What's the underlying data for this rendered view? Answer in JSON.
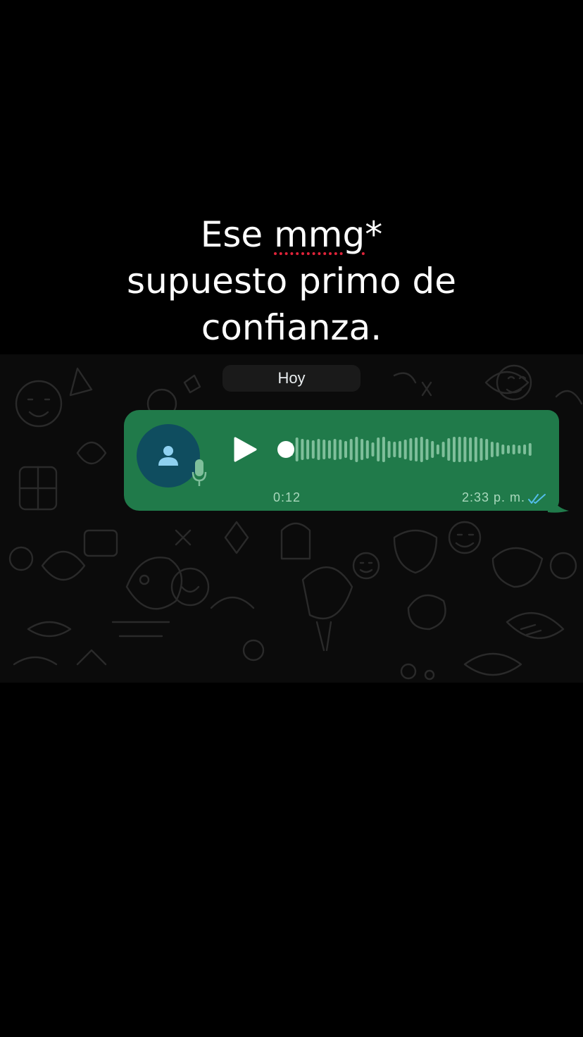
{
  "caption": {
    "line1_prefix": "Ese ",
    "line1_word": "mmg",
    "line1_suffix": "*",
    "line2": "supuesto primo de",
    "line3": "confianza."
  },
  "chat": {
    "date_chip": "Hoy",
    "voice_message": {
      "duration": "0:12",
      "time": "2:33 p. m.",
      "status": "read",
      "status_icon": "double-check-icon",
      "play_icon": "play-icon",
      "avatar_icon": "person-icon",
      "mic_icon": "microphone-icon",
      "progress": 0
    }
  },
  "colors": {
    "page_background": "#000000",
    "chat_background": "#0b0b0b",
    "bubble": "#207a4a",
    "avatar": "#0f4d5f",
    "read_ticks": "#53bdeb",
    "spellcheck_underline": "#e0243a"
  }
}
